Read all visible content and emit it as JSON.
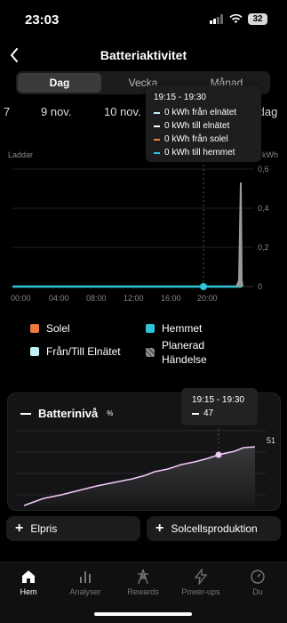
{
  "status": {
    "time": "23:03",
    "battery": "32"
  },
  "header": {
    "title": "Batteriaktivitet"
  },
  "segments": {
    "day": "Dag",
    "week": "Vecka",
    "month": "Månad"
  },
  "dates": [
    "7",
    "9 nov.",
    "10 nov.",
    "Idag"
  ],
  "tooltip": {
    "time": "19:15 - 19:30",
    "rows": [
      {
        "text": "0 kWh från elnätet",
        "color": "#bff0f6"
      },
      {
        "text": "0 kWh till elnätet",
        "color": "#ffffff"
      },
      {
        "text": "0 kWh från solel",
        "color": "#f07a3b"
      },
      {
        "text": "0 kWh till hemmet",
        "color": "#2fc5d8"
      }
    ]
  },
  "chart": {
    "charging_label": "Laddar",
    "unit": "kWh",
    "y_ticks": [
      "0,6",
      "0,4",
      "0,2",
      "0"
    ],
    "x_ticks": [
      "00:00",
      "04:00",
      "08:00",
      "12:00",
      "16:00",
      "20:00"
    ]
  },
  "chart_data": {
    "type": "line",
    "x_ticks": [
      "00:00",
      "04:00",
      "08:00",
      "12:00",
      "16:00",
      "20:00"
    ],
    "y_ticks": [
      0,
      0.2,
      0.4,
      0.6
    ],
    "unit": "kWh",
    "series": [
      {
        "name": "Hemmet",
        "color": "#2fc5d8",
        "values_note": "0 across the day"
      },
      {
        "name": "Planerad Händelse",
        "color": "#9a9a9a",
        "peak": 0.54,
        "peak_at": "23:00"
      }
    ],
    "ylim": [
      0,
      0.6
    ]
  },
  "legend": {
    "solar": "Solel",
    "home": "Hemmet",
    "grid": "Från/Till Elnätet",
    "planned": "Planerad Händelse",
    "colors": {
      "solar": "#f07a3b",
      "home": "#2fc5d8",
      "grid": "#bff0f6",
      "planned": "#666666"
    }
  },
  "battery": {
    "title": "Batterinivå",
    "unit": "%",
    "value_label": "51",
    "tooltip_time": "19:15 - 19:30",
    "tooltip_value": "47"
  },
  "actions": {
    "price": "Elpris",
    "solar": "Solcellsproduktion"
  },
  "tabs": [
    {
      "label": "Hem",
      "icon": "home-icon"
    },
    {
      "label": "Analyser",
      "icon": "bar-chart-icon"
    },
    {
      "label": "Rewards",
      "icon": "tower-icon"
    },
    {
      "label": "Power-ups",
      "icon": "bolt-icon"
    },
    {
      "label": "Du",
      "icon": "gauge-icon"
    }
  ]
}
